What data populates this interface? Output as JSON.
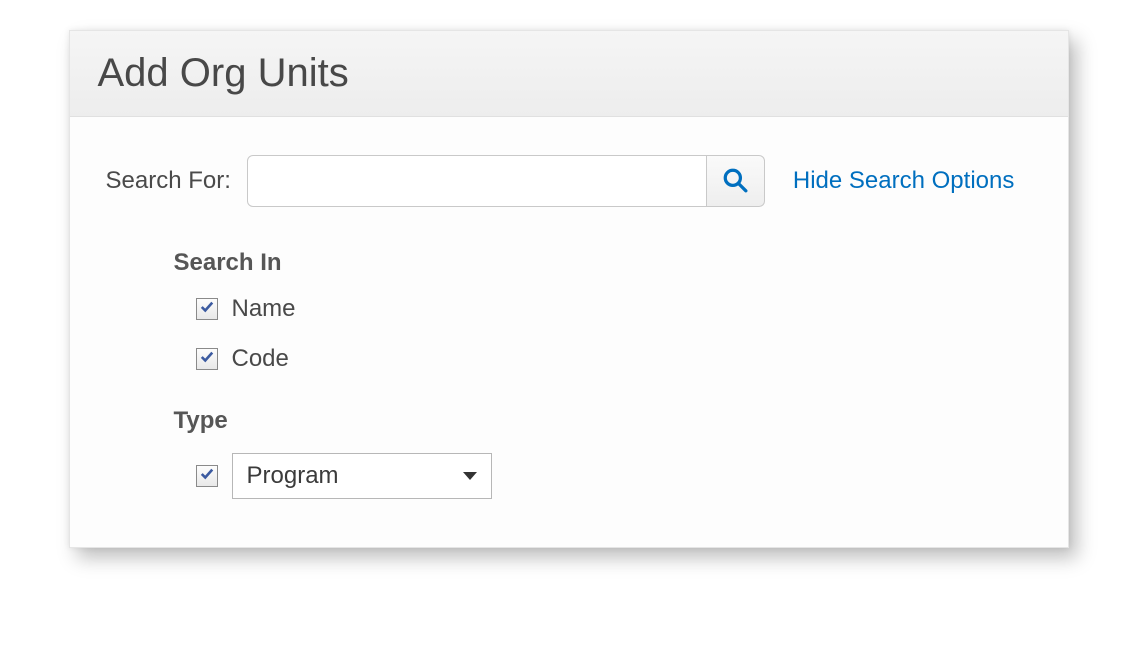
{
  "header": {
    "title": "Add Org Units"
  },
  "search": {
    "label": "Search For:",
    "value": "",
    "placeholder": "",
    "toggle_link": "Hide Search Options"
  },
  "options": {
    "search_in": {
      "group_label": "Search In",
      "name": {
        "label": "Name",
        "checked": true
      },
      "code": {
        "label": "Code",
        "checked": true
      }
    },
    "type": {
      "group_label": "Type",
      "enabled": true,
      "selected": "Program"
    }
  }
}
